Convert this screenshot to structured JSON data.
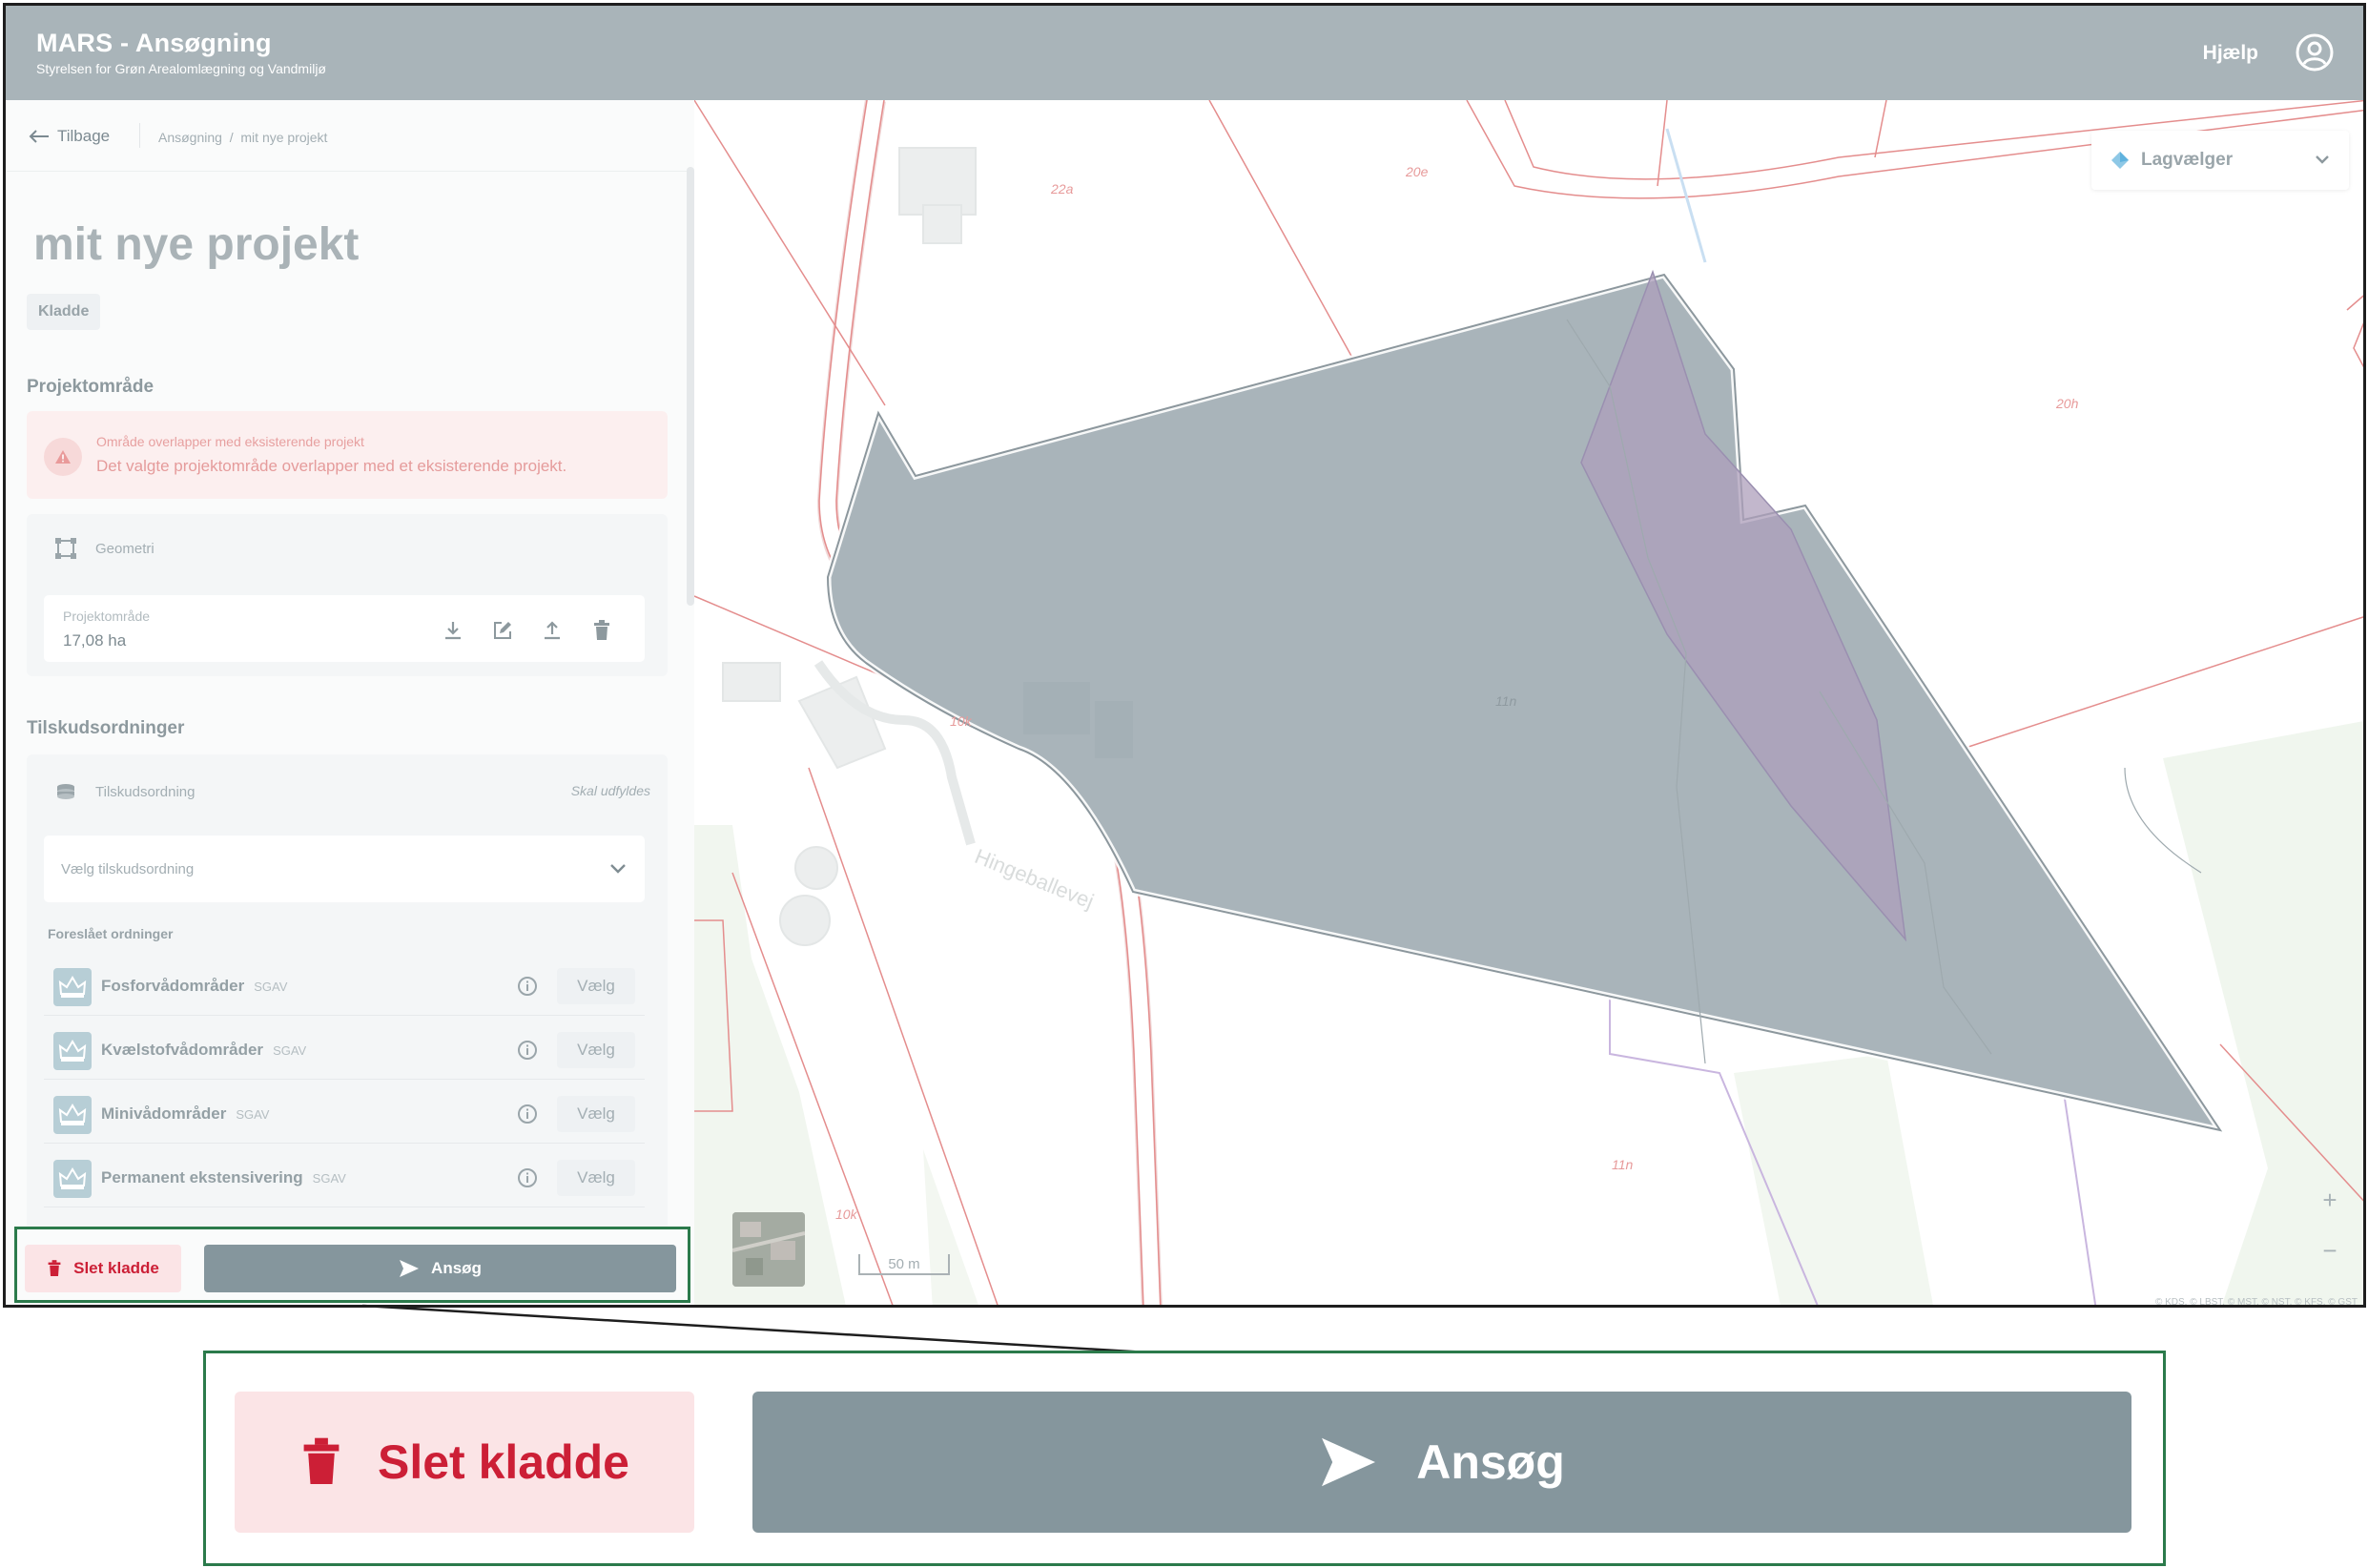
{
  "header": {
    "app_title": "MARS - Ansøgning",
    "subtitle": "Styrelsen for Grøn Arealomlægning og Vandmiljø",
    "help_label": "Hjælp",
    "user_icon": "user-circle-icon"
  },
  "breadcrumb": {
    "back_label": "Tilbage",
    "items": [
      "Ansøgning",
      "mit nye projekt"
    ],
    "separator": "/"
  },
  "project": {
    "title": "mit nye projekt",
    "status_badge": "Kladde"
  },
  "project_area": {
    "section_title": "Projektområde",
    "alert": {
      "title": "Område overlapper med eksisterende projekt",
      "message": "Det valgte projektområde overlapper med et eksisterende projekt."
    },
    "geometry_label": "Geometri",
    "area_label": "Projektområde",
    "area_value": "17,08 ha",
    "tools": [
      "download-icon",
      "edit-icon",
      "upload-icon",
      "delete-icon"
    ]
  },
  "subsidies": {
    "section_title": "Tilskudsordninger",
    "header_label": "Tilskudsordning",
    "status": "Skal udfyldes",
    "select_placeholder": "Vælg tilskudsordning",
    "suggested_title": "Foreslået ordninger",
    "choose_label": "Vælg",
    "items": [
      {
        "name": "Fosforvådområder",
        "org": "SGAV"
      },
      {
        "name": "Kvælstofvådområder",
        "org": "SGAV"
      },
      {
        "name": "Minivådområder",
        "org": "SGAV"
      },
      {
        "name": "Permanent ekstensivering",
        "org": "SGAV"
      }
    ]
  },
  "footer": {
    "delete_label": "Slet kladde",
    "apply_label": "Ansøg"
  },
  "map": {
    "layer_picker_label": "Lagvælger",
    "zoom_in": "+",
    "zoom_out": "−",
    "scale_label": "50 m",
    "attribution": "© KDS, © LBST, © MST, © NST, © KFS, © GST",
    "road_name": "Hingeballevej",
    "parcel_labels": [
      "22a",
      "20e",
      "20h",
      "10k",
      "11n",
      "10k",
      "11n"
    ]
  },
  "inset": {
    "delete_label": "Slet kladde",
    "apply_label": "Ansøg"
  },
  "colors": {
    "header_bg": "#a9b4b9",
    "delete_text": "#cc1f36",
    "delete_bg": "#fbe4e6",
    "apply_bg": "#85969d",
    "highlight_border": "#2b7a4b",
    "polygon_fill": "#a7b3b9",
    "overlap_fill": "#b3a8bd"
  }
}
